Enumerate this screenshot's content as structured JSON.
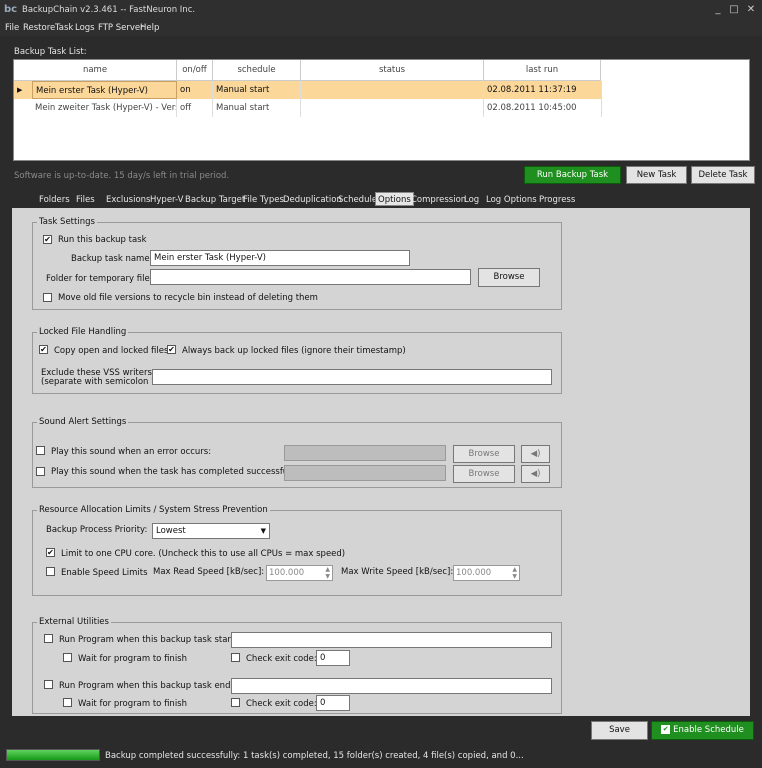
{
  "window": {
    "logo": "bc",
    "title": "BackupChain v2.3.461 -- FastNeuron Inc.",
    "min": "_",
    "max": "□",
    "close": "✕"
  },
  "menu": [
    "File",
    "Restore",
    "Task",
    "Logs",
    "FTP Server",
    "Help"
  ],
  "task_list": {
    "label": "Backup Task List:",
    "columns": [
      "name",
      "on/off",
      "schedule",
      "status",
      "last run"
    ],
    "rows": [
      {
        "name": "Mein erster Task (Hyper-V)",
        "onoff": "on",
        "schedule": "Manual start",
        "status": "",
        "last_run": "02.08.2011 11:37:19"
      },
      {
        "name": "Mein zweiter Task (Hyper-V) - Versch...",
        "onoff": "off",
        "schedule": "Manual start",
        "status": "",
        "last_run": "02.08.2011 10:45:00"
      }
    ]
  },
  "trial_text": "Software is up-to-date. 15 day/s left in trial period.",
  "actions": {
    "run": "Run Backup Task",
    "new": "New Task",
    "delete": "Delete Task"
  },
  "tabs": [
    "Folders",
    "Files",
    "Exclusions",
    "Hyper-V",
    "Backup Target",
    "File Types",
    "Deduplication",
    "Schedule",
    "Options",
    "Compression",
    "Log",
    "Log Options",
    "Progress"
  ],
  "active_tab": "Options",
  "task_settings": {
    "title": "Task Settings",
    "run_label": "Run this backup task",
    "run_checked": true,
    "name_label": "Backup task name:",
    "name_value": "Mein erster Task (Hyper-V)",
    "temp_label": "Folder for temporary files:",
    "temp_value": "",
    "browse": "Browse",
    "recycle_label": "Move old file versions to recycle bin instead of deleting them",
    "recycle_checked": false
  },
  "locked": {
    "title": "Locked File Handling",
    "copy_label": "Copy open and locked files",
    "copy_checked": true,
    "always_label": "Always back up locked files (ignore their timestamp)",
    "always_checked": true,
    "vss_label1": "Exclude these VSS writers:",
    "vss_label2": "(separate with semicolon ';')",
    "vss_value": ""
  },
  "sound": {
    "title": "Sound Alert Settings",
    "error_label": "Play this sound when an error occurs:",
    "success_label": "Play this sound when the task has completed successfully:",
    "browse": "Browse",
    "speaker_icon": "speaker-icon"
  },
  "resource": {
    "title": "Resource Allocation Limits / System Stress Prevention",
    "priority_label": "Backup Process Priority:",
    "priority_value": "Lowest",
    "cpu_label": "Limit to one CPU core. (Uncheck this to use all CPUs = max speed)",
    "cpu_checked": true,
    "speed_label": "Enable Speed Limits",
    "speed_checked": false,
    "read_label": "Max Read Speed [kB/sec]:",
    "read_value": "100.000",
    "write_label": "Max Write Speed [kB/sec]:",
    "write_value": "100.000"
  },
  "external": {
    "title": "External Utilities",
    "start_label": "Run Program when this backup task starts:",
    "end_label": "Run Program when this backup task ends:",
    "wait_label": "Wait for program to finish",
    "exit_label": "Check exit code:",
    "exit_value": "0"
  },
  "bottom": {
    "save": "Save",
    "enable": "Enable Schedule"
  },
  "status": {
    "text": "Backup completed successfully: 1 task(s) completed, 15 folder(s) created, 4 file(s) copied, and 0...",
    "progress": 1.0
  },
  "colors": {
    "accent_green": "#1f8f1f",
    "selected_row": "#fbd79a",
    "panel": "#d4d4d4"
  }
}
